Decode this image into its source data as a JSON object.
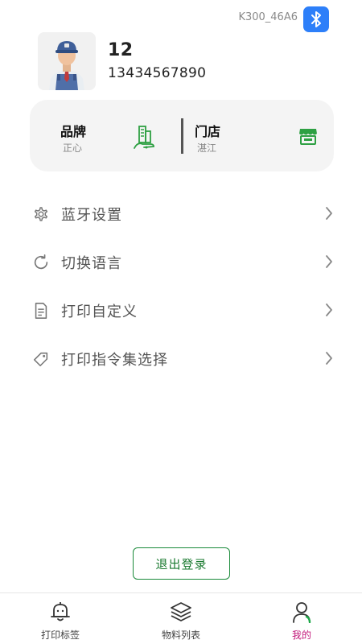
{
  "header": {
    "device_name": "K300_46A6",
    "bluetooth_icon": "bluetooth-icon"
  },
  "profile": {
    "name": "12",
    "phone": "13434567890",
    "avatar_icon": "user-avatar"
  },
  "info_card": {
    "brand_title": "品牌",
    "brand_value": "正心",
    "brand_icon": "building-icon",
    "store_title": "门店",
    "store_value": "湛江",
    "store_icon": "store-icon",
    "accent_color": "#2ea043"
  },
  "menu": {
    "items": [
      {
        "label": "蓝牙设置",
        "icon": "gear-icon"
      },
      {
        "label": "切换语言",
        "icon": "refresh-icon"
      },
      {
        "label": "打印自定义",
        "icon": "document-icon"
      },
      {
        "label": "打印指令集选择",
        "icon": "tag-icon"
      }
    ]
  },
  "logout": {
    "label": "退出登录",
    "color": "#1a8a3a"
  },
  "tabbar": {
    "tabs": [
      {
        "label": "打印标签",
        "icon": "print-label-icon",
        "active": false
      },
      {
        "label": "物料列表",
        "icon": "layers-icon",
        "active": false
      },
      {
        "label": "我的",
        "icon": "profile-icon",
        "active": true
      }
    ],
    "active_color": "#c2187a"
  }
}
